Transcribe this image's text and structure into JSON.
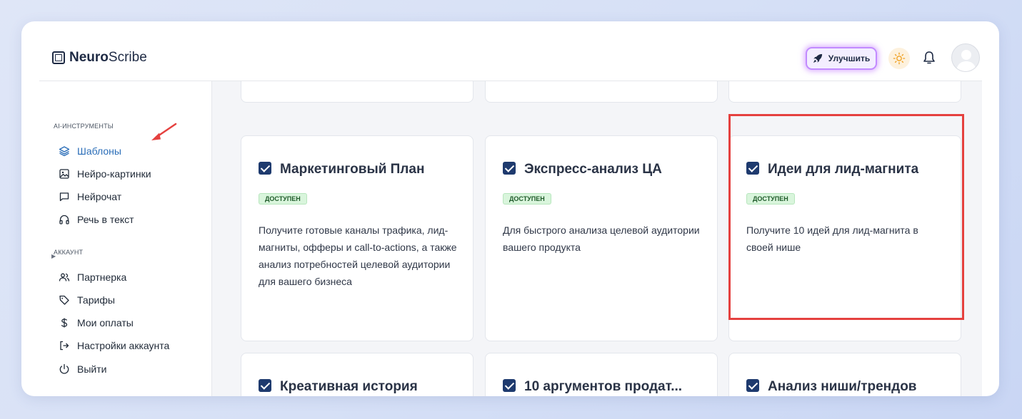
{
  "header": {
    "logo_bold": "Neuro",
    "logo_rest": "Scribe",
    "upgrade_label": "Улучшить"
  },
  "sidebar": {
    "section_ai": "AI-ИНСТРУМЕНТЫ",
    "ai_items": [
      {
        "label": "Шаблоны",
        "icon": "layers-icon",
        "active": true
      },
      {
        "label": "Нейро-картинки",
        "icon": "image-icon"
      },
      {
        "label": "Нейрочат",
        "icon": "chat-icon"
      },
      {
        "label": "Речь в текст",
        "icon": "headphones-icon"
      }
    ],
    "section_account": "АККАУНТ",
    "account_items": [
      {
        "label": "Партнерка",
        "icon": "users-icon"
      },
      {
        "label": "Тарифы",
        "icon": "tag-icon"
      },
      {
        "label": "Мои оплаты",
        "icon": "dollar-icon"
      },
      {
        "label": "Настройки аккаунта",
        "icon": "login-icon"
      },
      {
        "label": "Выйти",
        "icon": "power-icon"
      }
    ]
  },
  "cards": [
    {
      "title": "Маркетинговый План",
      "badge": "ДОСТУПЕН",
      "desc": "Получите готовые каналы трафика, лид-магниты, офферы и call-to-actions, а также анализ потребностей целевой аудитории для вашего бизнеса"
    },
    {
      "title": "Экспресс-анализ ЦА",
      "badge": "ДОСТУПЕН",
      "desc": "Для быстрого анализа целевой аудитории вашего продукта"
    },
    {
      "title": "Идеи для лид-магнита",
      "badge": "ДОСТУПЕН",
      "desc": "Получите 10 идей для лид-магнита в своей нише"
    },
    {
      "title": "Креативная история"
    },
    {
      "title": "10 аргументов продат..."
    },
    {
      "title": "Анализ ниши/трендов"
    }
  ],
  "colors": {
    "accent": "#2a6db8",
    "highlight": "#e5413f",
    "badge_bg": "#d9f5dc",
    "upgrade_glow": "#c28bff"
  }
}
